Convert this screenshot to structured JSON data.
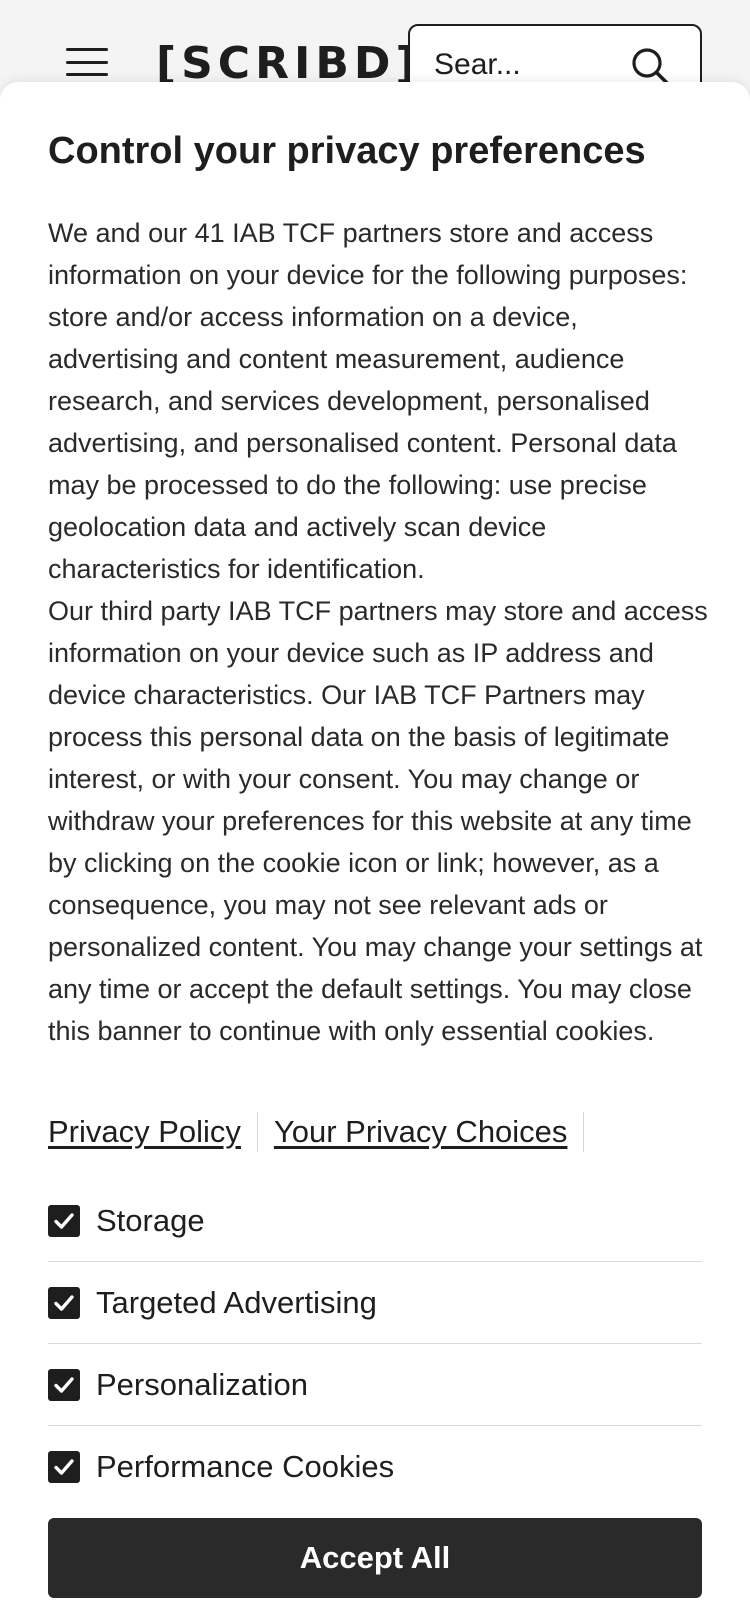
{
  "header": {
    "logo_text": "[SCRIBD]",
    "search_placeholder": "Sear...",
    "menu_icon": "hamburger-menu-icon",
    "search_icon": "magnifier-search-icon"
  },
  "consent": {
    "title": "Control your privacy preferences",
    "body_paragraphs": [
      "We and our 41 IAB TCF partners store and access information on your device for the following purposes: store and/or access information on a device, advertising and content measurement, audience research, and services development, personalised advertising, and personalised content. Personal data may be processed to do the following: use precise geolocation data and actively scan device characteristics for identification.",
      "Our third party IAB TCF partners may store and access information on your device such as IP address and device characteristics. Our IAB TCF Partners may process this personal data on the basis of legitimate interest, or with your consent. You may change or withdraw your preferences for this website at any time by clicking on the cookie icon or link; however, as a consequence, you may not see relevant ads or personalized content. You may change your settings at any time or accept the default settings. You may close this banner to continue with only essential cookies."
    ],
    "links": {
      "privacy_policy": "Privacy Policy",
      "privacy_choices": "Your Privacy Choices"
    },
    "options": [
      {
        "label": "Storage",
        "checked": true
      },
      {
        "label": "Targeted Advertising",
        "checked": true
      },
      {
        "label": "Personalization",
        "checked": true
      },
      {
        "label": "Performance Cookies",
        "checked": true
      }
    ],
    "accept_label": "Accept All"
  },
  "colors": {
    "text": "#1e1e1e",
    "button_bg": "#2a2a2a",
    "button_text": "#ffffff",
    "divider": "#dadada"
  }
}
